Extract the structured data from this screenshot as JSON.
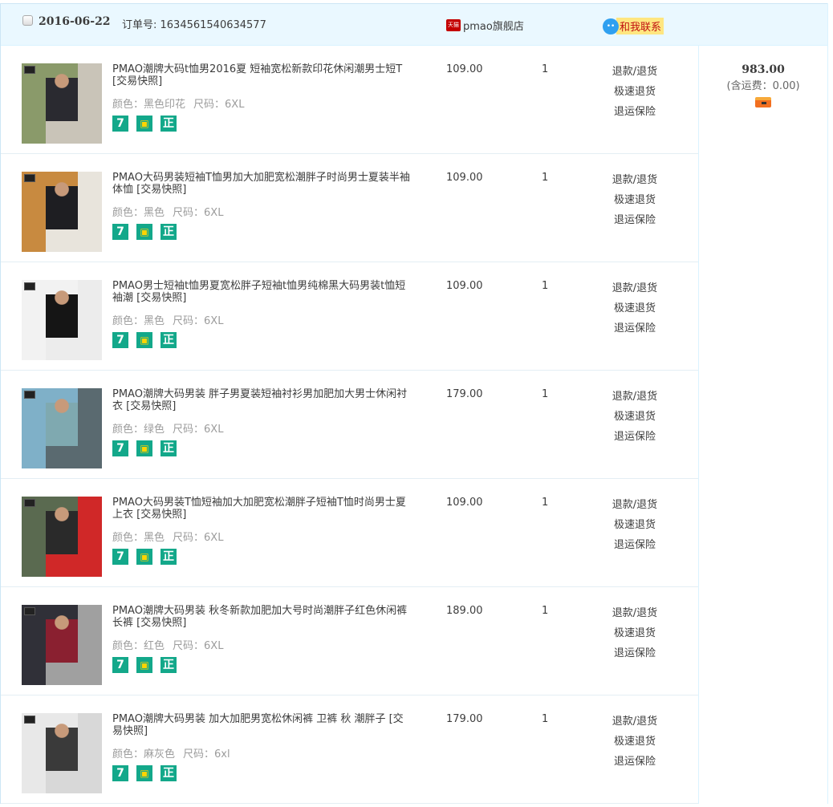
{
  "order": {
    "date": "2016-06-22",
    "order_no_label": "订单号: 1634561540634577",
    "shop_badge": "天猫",
    "shop_name": "pmao旗舰店",
    "contact_label": "和我联系",
    "total": "983.00",
    "shipping_note": "(含运费：0.00)"
  },
  "actions": [
    "退款/退货",
    "极速退货",
    "退运保险"
  ],
  "badges": [
    "7",
    "bag",
    "正"
  ],
  "items": [
    {
      "title": "PMAO潮牌大码t恤男2016夏 短袖宽松新款印花休闲潮男士短T [交易快照]",
      "color": "颜色：黑色印花",
      "size": "尺码：6XL",
      "price": "109.00",
      "qty": "1",
      "img": [
        "#8a9a6a",
        "#2a2a30",
        "#c9c4b8"
      ]
    },
    {
      "title": "PMAO大码男装短袖T恤男加大加肥宽松潮胖子时尚男士夏装半袖体恤 [交易快照]",
      "color": "颜色：黑色",
      "size": "尺码：6XL",
      "price": "109.00",
      "qty": "1",
      "img": [
        "#c88a40",
        "#1e1e22",
        "#e8e4dc"
      ]
    },
    {
      "title": "PMAO男士短袖t恤男夏宽松胖子短袖t恤男纯棉黑大码男装t恤短袖潮 [交易快照]",
      "color": "颜色：黑色",
      "size": "尺码：6XL",
      "price": "109.00",
      "qty": "1",
      "img": [
        "#f2f2f2",
        "#151515",
        "#ececec"
      ]
    },
    {
      "title": "PMAO潮牌大码男装 胖子男夏装短袖衬衫男加肥加大男士休闲衬衣 [交易快照]",
      "color": "颜色：绿色",
      "size": "尺码：6XL",
      "price": "179.00",
      "qty": "1",
      "img": [
        "#7fb0c8",
        "#7fa9b0",
        "#5a6a70"
      ]
    },
    {
      "title": "PMAO大码男装T恤短袖加大加肥宽松潮胖子短袖T恤时尚男士夏上衣 [交易快照]",
      "color": "颜色：黑色",
      "size": "尺码：6XL",
      "price": "109.00",
      "qty": "1",
      "img": [
        "#5a6a50",
        "#2a2a2a",
        "#d02828"
      ]
    },
    {
      "title": "PMAO潮牌大码男装 秋冬新款加肥加大号时尚潮胖子红色休闲裤长裤 [交易快照]",
      "color": "颜色：红色",
      "size": "尺码：6XL",
      "price": "189.00",
      "qty": "1",
      "img": [
        "#303038",
        "#8a2030",
        "#a0a0a0"
      ]
    },
    {
      "title": "PMAO潮牌大码男装 加大加肥男宽松休闲裤 卫裤 秋 潮胖子 [交易快照]",
      "color": "颜色：麻灰色",
      "size": "尺码：6xl",
      "price": "179.00",
      "qty": "1",
      "img": [
        "#e8e8e8",
        "#3a3a3a",
        "#d8d8d8"
      ]
    }
  ]
}
